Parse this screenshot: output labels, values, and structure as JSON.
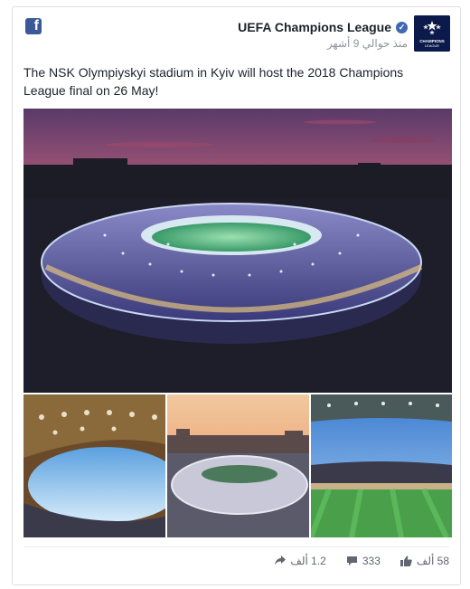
{
  "post": {
    "page_name": "UEFA Champions League",
    "timestamp": "منذ حوالي 9 أشهر",
    "text": "The NSK Olympiyskyi stadium in Kyiv will host the 2018 Champions League final on 26 May!",
    "avatar_text": "CHAMPIONS LEAGUE"
  },
  "stats": {
    "shares": "1.2 ألف",
    "comments": "333",
    "likes": "58 ألف"
  },
  "icons": {
    "platform": "facebook-icon",
    "verified": "verified-badge-icon",
    "share": "share-arrow-icon",
    "comment": "comment-bubble-icon",
    "like": "thumbs-up-icon"
  },
  "colors": {
    "facebook_blue": "#3b5998",
    "verified_blue": "#4267b2",
    "meta_gray": "#90949c"
  }
}
